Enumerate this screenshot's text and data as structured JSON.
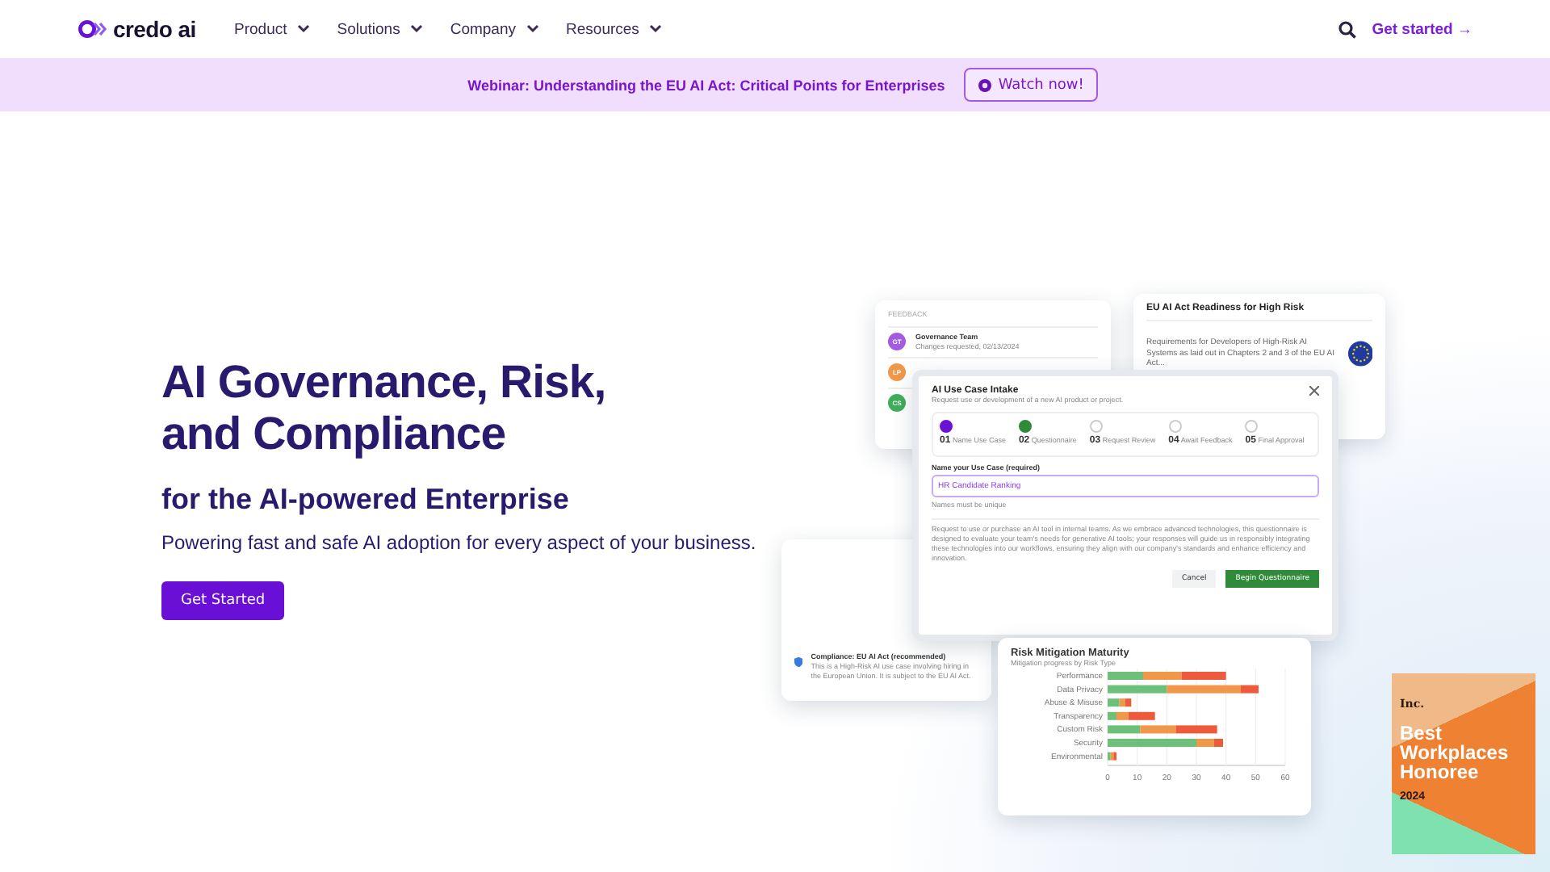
{
  "nav": {
    "logo": "credo ai",
    "menu": [
      {
        "label": "Product"
      },
      {
        "label": "Solutions"
      },
      {
        "label": "Company"
      },
      {
        "label": "Resources"
      }
    ],
    "cta": "Get started →"
  },
  "banner": {
    "text": "Webinar: Understanding the EU AI Act: Critical Points for Enterprises",
    "button": "Watch now!"
  },
  "hero": {
    "title": "AI Governance, Risk, and Compliance",
    "subtitle": "for the AI-powered Enterprise",
    "text": "Powering fast and safe AI adoption for every aspect of your business.",
    "button": "Get Started"
  },
  "illustration": {
    "feedback": {
      "heading": "FEEDBACK",
      "items": [
        {
          "initials": "GT",
          "color": "#a35be0",
          "title": "Governance Team",
          "note": "Changes requested, 02/13/2024"
        },
        {
          "initials": "LP",
          "color": "#f0974a"
        },
        {
          "initials": "CS",
          "color": "#3fae5a"
        }
      ]
    },
    "eu_card": {
      "title": "EU AI Act Readiness for High Risk",
      "text": "Requirements for Developers of High-Risk AI Systems as laid out in Chapters 2 and 3 of the EU AI Act..."
    },
    "intake": {
      "title": "AI Use Case Intake",
      "subtitle": "Request use or development of a new AI product or project.",
      "steps": [
        {
          "number": "01",
          "label": "Name Use Case",
          "done": true
        },
        {
          "number": "02",
          "label": "Questionnaire",
          "done": true
        },
        {
          "number": "03",
          "label": "Request Review",
          "done": false
        },
        {
          "number": "04",
          "label": "Await Feedback",
          "done": false
        },
        {
          "number": "05",
          "label": "Final Approval",
          "done": false
        }
      ],
      "field_label": "Name your Use Case (required)",
      "value": "HR Candidate Ranking",
      "hint": "Names must be unique",
      "description": "Request to use or purchase an AI tool in internal teams. As we embrace advanced technologies, this questionnaire is designed to evaluate your team's needs for generative AI tools; your responses will guide us in responsibly integrating these technologies into our workflows, ensuring they align with our company's standards and enhance efficiency and innovation.",
      "cancel": "Cancel",
      "submit": "Begin Questionnaire"
    },
    "compliance": {
      "title": "Compliance: EU AI Act (recommended)",
      "text": "This is a High-Risk AI use case involving hiring in the European Union. It is subject to the EU AI Act."
    },
    "risk": {
      "title": "Risk Mitigation Maturity",
      "subtitle": "Mitigation progress by Risk Type",
      "chart_data": {
        "type": "bar",
        "orientation": "horizontal",
        "stacked": true,
        "categories": [
          "Performance",
          "Data Privacy",
          "Abuse & Misuse",
          "Transparency",
          "Custom Risk",
          "Security",
          "Environmental"
        ],
        "series": [
          {
            "color": "#6cc07a",
            "values": [
              12,
              20,
              4,
              3,
              11,
              30,
              1
            ]
          },
          {
            "color": "#f0974a",
            "values": [
              13,
              25,
              2,
              4,
              12,
              6,
              1
            ]
          },
          {
            "color": "#ee5a3c",
            "values": [
              15,
              6,
              2,
              9,
              14,
              3,
              1
            ]
          }
        ],
        "grid": true,
        "xlim": [
          0,
          60
        ],
        "xticks": [
          0,
          10,
          20,
          30,
          40,
          50,
          60
        ]
      }
    }
  },
  "badge": {
    "brand": "Inc.",
    "title": "Best Workplaces Honoree",
    "year": "2024"
  }
}
